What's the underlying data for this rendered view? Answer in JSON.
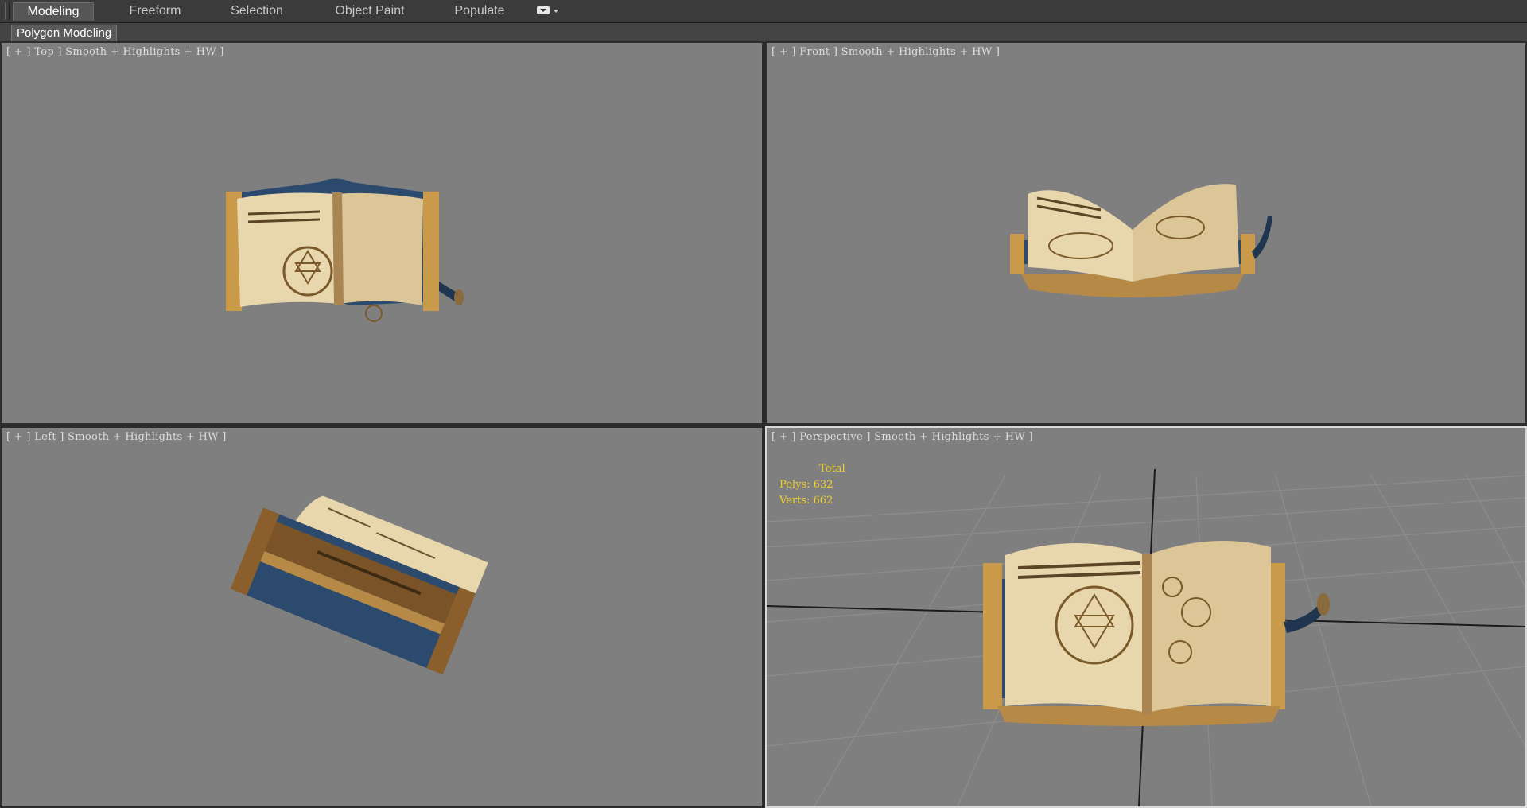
{
  "ribbon": {
    "tabs": [
      {
        "label": "Modeling",
        "active": true
      },
      {
        "label": "Freeform"
      },
      {
        "label": "Selection"
      },
      {
        "label": "Object Paint"
      },
      {
        "label": "Populate"
      }
    ],
    "panel_label": "Polygon Modeling"
  },
  "viewports": {
    "top": {
      "label": "[ + ] Top ] Smooth + Highlights + HW ]"
    },
    "front": {
      "label": "[ + ] Front ] Smooth + Highlights + HW ]"
    },
    "left": {
      "label": "[ + ] Left ] Smooth + Highlights + HW ]"
    },
    "perspective": {
      "label": "[ + ] Perspective ] Smooth + Highlights + HW ]",
      "stats": {
        "header": "Total",
        "polys_label": "Polys:",
        "polys": "632",
        "verts_label": "Verts:",
        "verts": "662"
      }
    }
  },
  "colors": {
    "viewport_bg": "#7f7f7f",
    "stats_text": "#f2d22a",
    "page_paper": "#e8d6ac",
    "book_gold": "#c89a4a",
    "book_blue": "#2c4a6e"
  }
}
